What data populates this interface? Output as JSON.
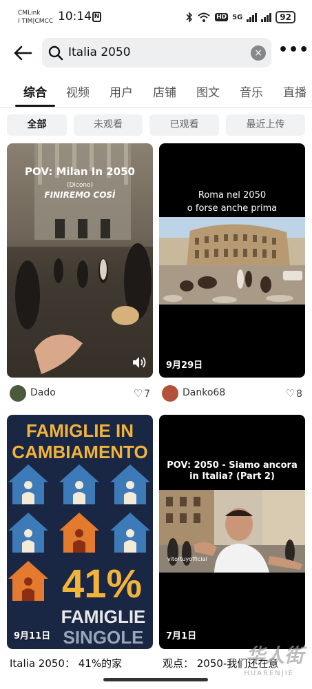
{
  "status_bar": {
    "carrier_line1": "CMLink",
    "carrier_line2": "I TIM|CMCC",
    "time": "10:14",
    "network_hd": "HD",
    "network_5g": "5G",
    "battery": "92"
  },
  "search": {
    "query": "Italia 2050",
    "clear_glyph": "×",
    "more_glyph": "•••"
  },
  "tabs": [
    "综合",
    "视频",
    "用户",
    "店铺",
    "图文",
    "音乐",
    "直播"
  ],
  "active_tab": "综合",
  "filters": [
    "全部",
    "未观看",
    "已观看",
    "最近上传"
  ],
  "active_filter": "全部",
  "results": [
    {
      "overlay_title": "POV: Milan In 2050",
      "overlay_sub": "(Dicono)",
      "overlay_sub2": "FINIREMO COSÌ",
      "author": "Dado",
      "likes": "7",
      "has_sound_icon": true
    },
    {
      "overlay_title_line1": "Roma nel 2050",
      "overlay_title_line2": "o forse anche prima",
      "date": "9月29日",
      "author": "Danko68",
      "likes": "8"
    },
    {
      "overlay_title_line1": "FAMIGLIE IN",
      "overlay_title_line2": "CAMBIAMENTO",
      "percent": "41%",
      "foot_line1": "FAMIGLIE",
      "foot_line2": "SINGOLE",
      "date": "9月11日",
      "title": "Italia 2050：  41%的家"
    },
    {
      "overlay_title_line1": "POV: 2050 - Siamo ancora",
      "overlay_title_line2": "in Italia? (Part 2)",
      "handle": "vitortuyofficial",
      "date": "7月1日",
      "title": "观点：  2050-我们还在意"
    }
  ],
  "watermark": "华人街",
  "watermark_sub": "HUARENJIE",
  "colors": {
    "accent_text": "#111111",
    "chip_bg": "#f1f2f4",
    "search_bg": "#eeeff1",
    "famiglie_yellow": "#f2b33b",
    "famiglie_navy": "#1a2744",
    "house_blue": "#3d7bb8",
    "house_orange": "#e47a2e"
  }
}
